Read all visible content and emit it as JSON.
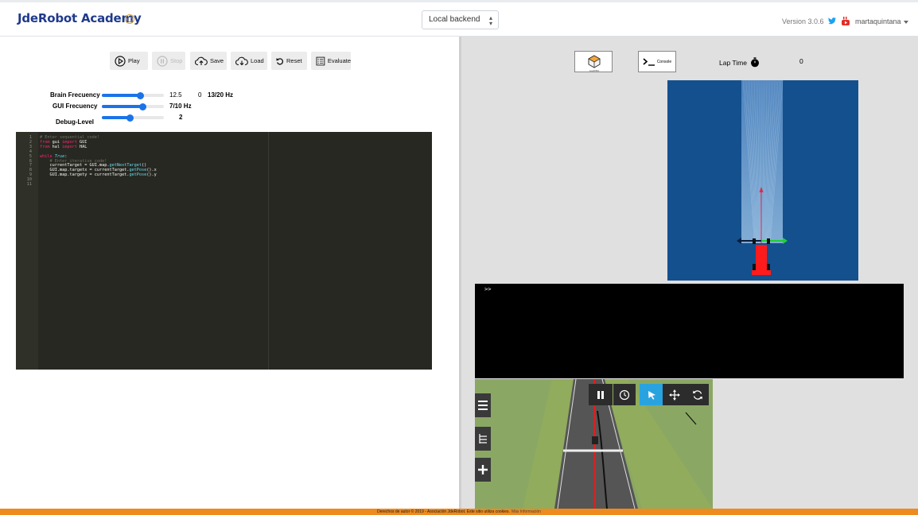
{
  "navbar": {
    "brand": "JdeRobot Academy",
    "backend_select": "Local backend",
    "version": "Version 3.0.6",
    "user": "martaquintana"
  },
  "toolbar": {
    "play": "Play",
    "stop": "Stop",
    "save": "Save",
    "load": "Load",
    "reset": "Reset",
    "evaluate": "Evaluate"
  },
  "frequencies": {
    "brain_label": "Brain Frecuency",
    "brain_value": "12.5",
    "brain_measured": "0",
    "brain_target": "13/20 Hz",
    "brain_level": 0.62,
    "gui_label": "GUI Frecuency",
    "gui_value": "7/10 Hz",
    "gui_level": 0.66,
    "debug_label": "Debug-Level",
    "debug_value": "2",
    "debug_level": 0.45
  },
  "editor": {
    "lines": [
      {
        "n": "1",
        "tokens": [
          {
            "t": "# Enter sequential code!",
            "c": "c"
          }
        ]
      },
      {
        "n": "2",
        "tokens": [
          {
            "t": "from",
            "c": "k"
          },
          {
            "t": " gui ",
            "c": ""
          },
          {
            "t": "import",
            "c": "k"
          },
          {
            "t": " GUI",
            "c": ""
          }
        ]
      },
      {
        "n": "3",
        "tokens": [
          {
            "t": "from",
            "c": "k"
          },
          {
            "t": " hal ",
            "c": ""
          },
          {
            "t": "import",
            "c": "k"
          },
          {
            "t": " HAL",
            "c": ""
          }
        ]
      },
      {
        "n": "4",
        "tokens": []
      },
      {
        "n": "5",
        "tokens": [
          {
            "t": "while",
            "c": "k"
          },
          {
            "t": " ",
            "c": ""
          },
          {
            "t": "True",
            "c": "b"
          },
          {
            "t": ":",
            "c": ""
          }
        ]
      },
      {
        "n": "6",
        "tokens": [
          {
            "t": "    # Enter iterative code!",
            "c": "c"
          }
        ]
      },
      {
        "n": "7",
        "tokens": [
          {
            "t": "    currentTarget = GUI.map.",
            "c": ""
          },
          {
            "t": "getNextTarget",
            "c": "f"
          },
          {
            "t": "()",
            "c": ""
          }
        ]
      },
      {
        "n": "8",
        "tokens": [
          {
            "t": "    GUI.map.targetx = currentTarget.",
            "c": ""
          },
          {
            "t": "getPose",
            "c": "f"
          },
          {
            "t": "().x",
            "c": ""
          }
        ]
      },
      {
        "n": "9",
        "tokens": [
          {
            "t": "    GUI.map.targety = currentTarget.",
            "c": ""
          },
          {
            "t": "getPose",
            "c": "f"
          },
          {
            "t": "().y",
            "c": ""
          }
        ]
      },
      {
        "n": "10",
        "tokens": []
      },
      {
        "n": "11",
        "tokens": []
      }
    ]
  },
  "right": {
    "gazebo_icon": "gazebo-icon",
    "console_button": "Console",
    "lap_time_label": "Lap Time",
    "lap_time_value": "0",
    "console_prompt": ">>"
  },
  "footer": {
    "text": "Derechos de autor © 2019 - Asociación JdeRobot. Este sitio utiliza cookies.",
    "more": "Más Información"
  },
  "colors": {
    "accent_blue": "#1a73e8",
    "brand_blue": "#1f3a8a",
    "footer_orange": "#ee8a1e",
    "map_blue": "#14508e",
    "editor_bg": "#272822"
  }
}
